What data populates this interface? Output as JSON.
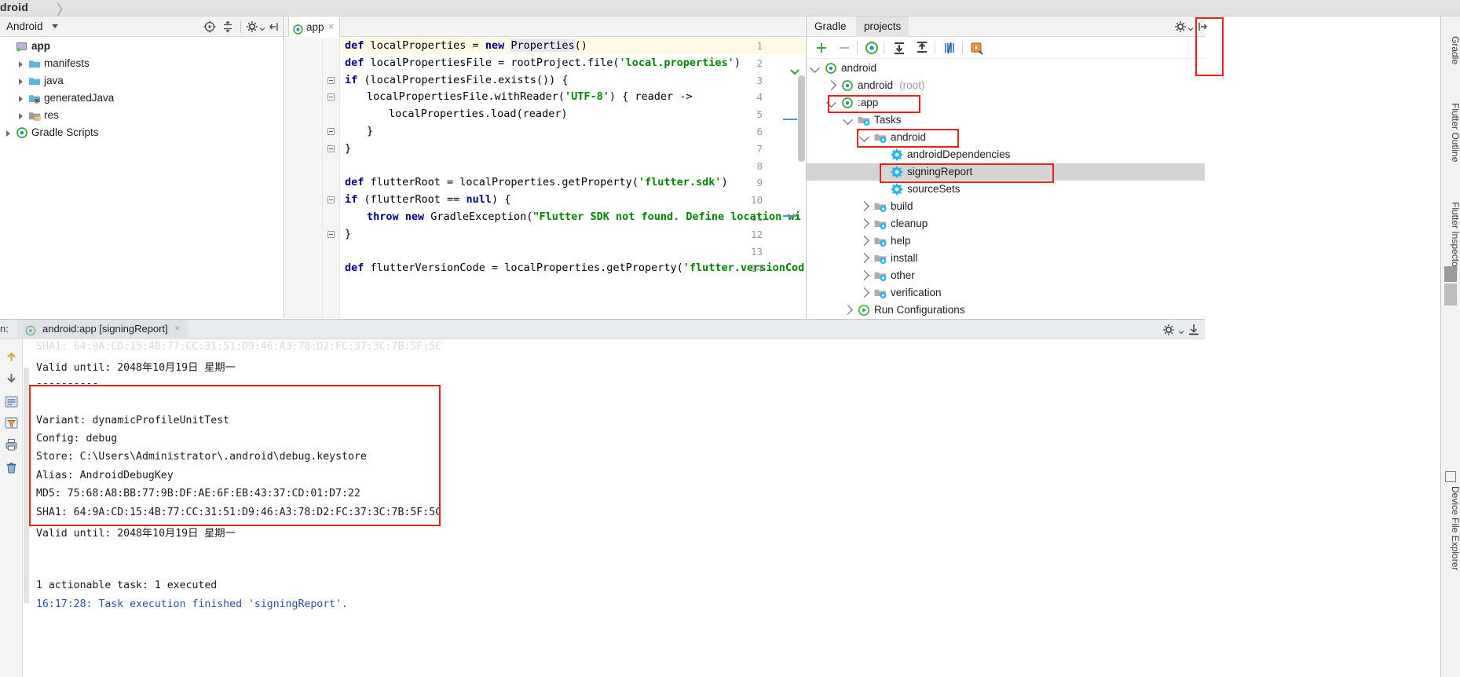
{
  "breadcrumb": {
    "text": "droid",
    "separator": "〉"
  },
  "project_panel": {
    "title": "Android",
    "toolbar": [
      {
        "name": "locate-icon",
        "tooltip": "Select Opened File"
      },
      {
        "name": "collapse-all-icon",
        "tooltip": "Collapse All"
      },
      {
        "name": "settings-gear-icon",
        "tooltip": "Settings"
      },
      {
        "name": "hide-panel-icon",
        "tooltip": "Hide"
      }
    ],
    "tree": [
      {
        "label": "app",
        "indent": 0,
        "icon": "module-icon",
        "expanded": true,
        "bold": true,
        "arrow": false
      },
      {
        "label": "manifests",
        "indent": 1,
        "icon": "folder-blue-icon",
        "expanded": false,
        "bold": false,
        "arrow": true
      },
      {
        "label": "java",
        "indent": 1,
        "icon": "folder-blue-icon",
        "expanded": false,
        "bold": false,
        "arrow": true
      },
      {
        "label": "generatedJava",
        "indent": 1,
        "icon": "folder-generated-icon",
        "expanded": false,
        "bold": false,
        "arrow": true
      },
      {
        "label": "res",
        "indent": 1,
        "icon": "folder-res-icon",
        "expanded": false,
        "bold": false,
        "arrow": true
      },
      {
        "label": "Gradle Scripts",
        "indent": 0,
        "icon": "gradle-icon",
        "expanded": false,
        "bold": false,
        "arrow": true
      }
    ]
  },
  "editor": {
    "tab": {
      "label": "app",
      "icon": "gradle-file-icon",
      "close": "×"
    },
    "lines": [
      {
        "n": "1",
        "tokens": [
          {
            "t": "def",
            "c": "kw"
          },
          {
            "t": " localProperties = ",
            "c": ""
          },
          {
            "t": "new",
            "c": "kw"
          },
          {
            "t": " ",
            "c": ""
          },
          {
            "t": "Properties",
            "c": "cls"
          },
          {
            "t": "()",
            "c": ""
          }
        ],
        "indent": 0,
        "highlight": true
      },
      {
        "n": "2",
        "tokens": [
          {
            "t": "def",
            "c": "kw"
          },
          {
            "t": " localPropertiesFile = rootProject.file(",
            "c": ""
          },
          {
            "t": "'local.properties'",
            "c": "str"
          },
          {
            "t": ")",
            "c": ""
          }
        ],
        "indent": 0,
        "highlight": false
      },
      {
        "n": "3",
        "tokens": [
          {
            "t": "if",
            "c": "kw"
          },
          {
            "t": " (localPropertiesFile.exists()) {",
            "c": ""
          }
        ],
        "indent": 0,
        "highlight": false,
        "fold": true
      },
      {
        "n": "4",
        "tokens": [
          {
            "t": "localPropertiesFile.withReader(",
            "c": ""
          },
          {
            "t": "'UTF-8'",
            "c": "str"
          },
          {
            "t": ") { reader ->",
            "c": ""
          }
        ],
        "indent": 1,
        "highlight": false,
        "fold": true
      },
      {
        "n": "5",
        "tokens": [
          {
            "t": "localProperties.load(reader)",
            "c": ""
          }
        ],
        "indent": 2,
        "highlight": false
      },
      {
        "n": "6",
        "tokens": [
          {
            "t": "}",
            "c": ""
          }
        ],
        "indent": 1,
        "highlight": false,
        "fold": true
      },
      {
        "n": "7",
        "tokens": [
          {
            "t": "}",
            "c": ""
          }
        ],
        "indent": 0,
        "highlight": false,
        "fold": true
      },
      {
        "n": "8",
        "tokens": [],
        "indent": 0,
        "highlight": false
      },
      {
        "n": "9",
        "tokens": [
          {
            "t": "def",
            "c": "kw"
          },
          {
            "t": " flutterRoot = localProperties.getProperty(",
            "c": ""
          },
          {
            "t": "'flutter.sdk'",
            "c": "str"
          },
          {
            "t": ")",
            "c": ""
          }
        ],
        "indent": 0,
        "highlight": false
      },
      {
        "n": "10",
        "tokens": [
          {
            "t": "if",
            "c": "kw"
          },
          {
            "t": " (flutterRoot == ",
            "c": ""
          },
          {
            "t": "null",
            "c": "kw"
          },
          {
            "t": ") {",
            "c": ""
          }
        ],
        "indent": 0,
        "highlight": false,
        "fold": true
      },
      {
        "n": "11",
        "tokens": [
          {
            "t": "throw new",
            "c": "kw"
          },
          {
            "t": " GradleException(",
            "c": ""
          },
          {
            "t": "\"Flutter SDK not found. Define location wi",
            "c": "str"
          }
        ],
        "indent": 1,
        "highlight": false
      },
      {
        "n": "12",
        "tokens": [
          {
            "t": "}",
            "c": ""
          }
        ],
        "indent": 0,
        "highlight": false,
        "fold": true
      },
      {
        "n": "13",
        "tokens": [],
        "indent": 0,
        "highlight": false
      },
      {
        "n": "14",
        "tokens": [
          {
            "t": "def",
            "c": "kw"
          },
          {
            "t": " flutterVersionCode = localProperties.getProperty(",
            "c": ""
          },
          {
            "t": "'flutter.versionCode'",
            "c": "str"
          },
          {
            "t": ")",
            "c": ""
          }
        ],
        "indent": 0,
        "highlight": false
      }
    ]
  },
  "gradle_panel": {
    "tabs": [
      {
        "label": "Gradle",
        "selected": false
      },
      {
        "label": "projects",
        "selected": true
      }
    ],
    "toolbar": [
      {
        "name": "add-icon",
        "glyph": "+"
      },
      {
        "name": "remove-icon",
        "glyph": "−"
      },
      {
        "name": "refresh-gradle-icon",
        "glyph": ""
      },
      {
        "name": "expand-all-icon",
        "glyph": ""
      },
      {
        "name": "collapse-all-icon",
        "glyph": ""
      },
      {
        "name": "toggle-offline-icon",
        "glyph": ""
      },
      {
        "name": "execute-gradle-task-icon",
        "glyph": ""
      }
    ],
    "settings_icon": "settings-gear-icon",
    "hide_icon": "hide-panel-icon",
    "tree": [
      {
        "label": "android",
        "suffix": "",
        "indent": 0,
        "icon": "gradle-project-icon",
        "state": "down",
        "selected": false
      },
      {
        "label": "android",
        "suffix": " (root)",
        "indent": 1,
        "icon": "gradle-project-icon",
        "state": "right",
        "selected": false
      },
      {
        "label": ":app",
        "suffix": "",
        "indent": 1,
        "icon": "gradle-project-icon",
        "state": "down",
        "selected": false
      },
      {
        "label": "Tasks",
        "suffix": "",
        "indent": 2,
        "icon": "task-folder-icon",
        "state": "down",
        "selected": false
      },
      {
        "label": "android",
        "suffix": "",
        "indent": 3,
        "icon": "task-folder-icon",
        "state": "down",
        "selected": false
      },
      {
        "label": "androidDependencies",
        "suffix": "",
        "indent": 4,
        "icon": "gear-task-icon",
        "state": "none",
        "selected": false
      },
      {
        "label": "signingReport",
        "suffix": "",
        "indent": 4,
        "icon": "gear-task-icon",
        "state": "none",
        "selected": true
      },
      {
        "label": "sourceSets",
        "suffix": "",
        "indent": 4,
        "icon": "gear-task-icon",
        "state": "none",
        "selected": false
      },
      {
        "label": "build",
        "suffix": "",
        "indent": 3,
        "icon": "task-folder-icon",
        "state": "right",
        "selected": false
      },
      {
        "label": "cleanup",
        "suffix": "",
        "indent": 3,
        "icon": "task-folder-icon",
        "state": "right",
        "selected": false
      },
      {
        "label": "help",
        "suffix": "",
        "indent": 3,
        "icon": "task-folder-icon",
        "state": "right",
        "selected": false
      },
      {
        "label": "install",
        "suffix": "",
        "indent": 3,
        "icon": "task-folder-icon",
        "state": "right",
        "selected": false
      },
      {
        "label": "other",
        "suffix": "",
        "indent": 3,
        "icon": "task-folder-icon",
        "state": "right",
        "selected": false
      },
      {
        "label": "verification",
        "suffix": "",
        "indent": 3,
        "icon": "task-folder-icon",
        "state": "right",
        "selected": false
      },
      {
        "label": "Run Configurations",
        "suffix": "",
        "indent": 2,
        "icon": "run-config-icon",
        "state": "right",
        "selected": false
      }
    ]
  },
  "right_rail": [
    {
      "label": "Gradle",
      "name": "rail-gradle"
    },
    {
      "label": "Flutter Outline",
      "name": "rail-flutter-outline"
    },
    {
      "label": "Flutter Inspector",
      "name": "rail-flutter-inspector"
    },
    {
      "label": "Device File Explorer",
      "name": "rail-device-file-explorer"
    }
  ],
  "run_panel": {
    "prefix_label": "n:",
    "tab": {
      "label": "android:app [signingReport]",
      "icon": "gradle-run-icon",
      "close": "×"
    },
    "right_icons": [
      {
        "name": "settings-gear-icon"
      },
      {
        "name": "download-export-icon"
      }
    ],
    "side_buttons": [
      {
        "name": "scroll-up-icon"
      },
      {
        "name": "scroll-down-icon"
      },
      {
        "name": "toggle-tasks-icon"
      },
      {
        "name": "filter-icon"
      },
      {
        "name": "print-icon"
      },
      {
        "name": "delete-icon"
      }
    ],
    "console_lines": [
      {
        "text": "SHA1: 64:9A:CD:15:4B:77:CC:31:51:D9:46:A3:78:D2:FC:37:3C:7B:5F:5C",
        "style": "cut"
      },
      {
        "text": "Valid until: 2048年10月19日 星期一",
        "style": ""
      },
      {
        "text": "----------",
        "style": ""
      },
      {
        "text": "",
        "style": ""
      },
      {
        "text": "Variant: dynamicProfileUnitTest",
        "style": ""
      },
      {
        "text": "Config: debug",
        "style": ""
      },
      {
        "text": "Store: C:\\Users\\Administrator\\.android\\debug.keystore",
        "style": ""
      },
      {
        "text": "Alias: AndroidDebugKey",
        "style": ""
      },
      {
        "text": "MD5: 75:68:A8:BB:77:9B:DF:AE:6F:EB:43:37:CD:01:D7:22",
        "style": ""
      },
      {
        "text": "SHA1: 64:9A:CD:15:4B:77:CC:31:51:D9:46:A3:78:D2:FC:37:3C:7B:5F:5C",
        "style": ""
      },
      {
        "text": "Valid until: 2048年10月19日 星期一",
        "style": ""
      },
      {
        "text": "",
        "style": ""
      },
      {
        "text": "",
        "style": ""
      },
      {
        "text": "1 actionable task: 1 executed",
        "style": ""
      },
      {
        "text": "16:17:28: Task execution finished 'signingReport'.",
        "style": "blue"
      }
    ]
  },
  "colors": {
    "accent_red": "#e8211a",
    "selection_grey": "#d4d4d4",
    "keyword_blue": "#000080",
    "string_green": "#008000",
    "task_blue": "#29b6e8",
    "gradle_green": "#4caf50",
    "console_blue": "#2c4fa0"
  }
}
